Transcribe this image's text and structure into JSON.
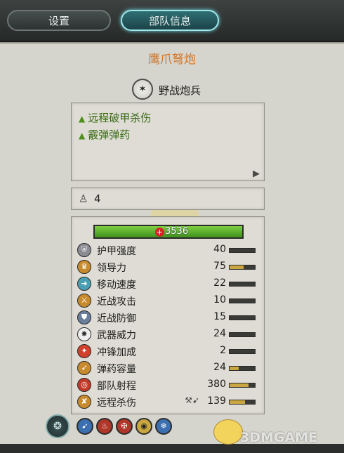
{
  "tabs": [
    {
      "label": "设置",
      "active": false
    },
    {
      "label": "部队信息",
      "active": true
    }
  ],
  "unit": {
    "name": "鹰爪弩炮",
    "class_label": "野战炮兵",
    "class_icon": "cannon-icon"
  },
  "attributes": [
    {
      "label": "远程破甲杀伤",
      "icon": "green-triangle-icon"
    },
    {
      "label": "霰弹弹药",
      "icon": "green-triangle-icon"
    }
  ],
  "men": {
    "icon": "soldier-icon",
    "value": "4"
  },
  "health": {
    "value": "3536",
    "fraction": 1.0,
    "color": "#5fb02e"
  },
  "stats": [
    {
      "label": "护甲强度",
      "value": "40",
      "fraction": 0.0,
      "icon": "armor-icon"
    },
    {
      "label": "领导力",
      "value": "75",
      "fraction": 0.55,
      "icon": "leadership-icon"
    },
    {
      "label": "移动速度",
      "value": "22",
      "fraction": 0.0,
      "icon": "speed-icon"
    },
    {
      "label": "近战攻击",
      "value": "10",
      "fraction": 0.0,
      "icon": "melee-attack-icon"
    },
    {
      "label": "近战防御",
      "value": "15",
      "fraction": 0.0,
      "icon": "melee-defence-icon"
    },
    {
      "label": "武器威力",
      "value": "24",
      "fraction": 0.0,
      "icon": "weapon-strength-icon"
    },
    {
      "label": "冲锋加成",
      "value": "2",
      "fraction": 0.0,
      "icon": "charge-bonus-icon"
    },
    {
      "label": "弹药容量",
      "value": "24",
      "fraction": 0.35,
      "icon": "ammunition-icon"
    },
    {
      "label": "部队射程",
      "value": "380",
      "fraction": 0.75,
      "icon": "range-icon"
    },
    {
      "label": "远程杀伤",
      "value": "139",
      "fraction": 0.6,
      "icon": "missile-damage-icon"
    }
  ],
  "abilities": [
    {
      "icon": "formation-icon"
    },
    {
      "icon": "crossbow-icon"
    },
    {
      "icon": "fire-icon"
    },
    {
      "icon": "anti-large-icon"
    },
    {
      "icon": "vision-icon"
    },
    {
      "icon": "frost-icon"
    }
  ],
  "watermark": "3DMGAME",
  "colors": {
    "accent": "#d0752a",
    "attribute_green": "#3a6b16",
    "tab_active": "#2f6f74",
    "stat_fill": "#c9a640"
  }
}
